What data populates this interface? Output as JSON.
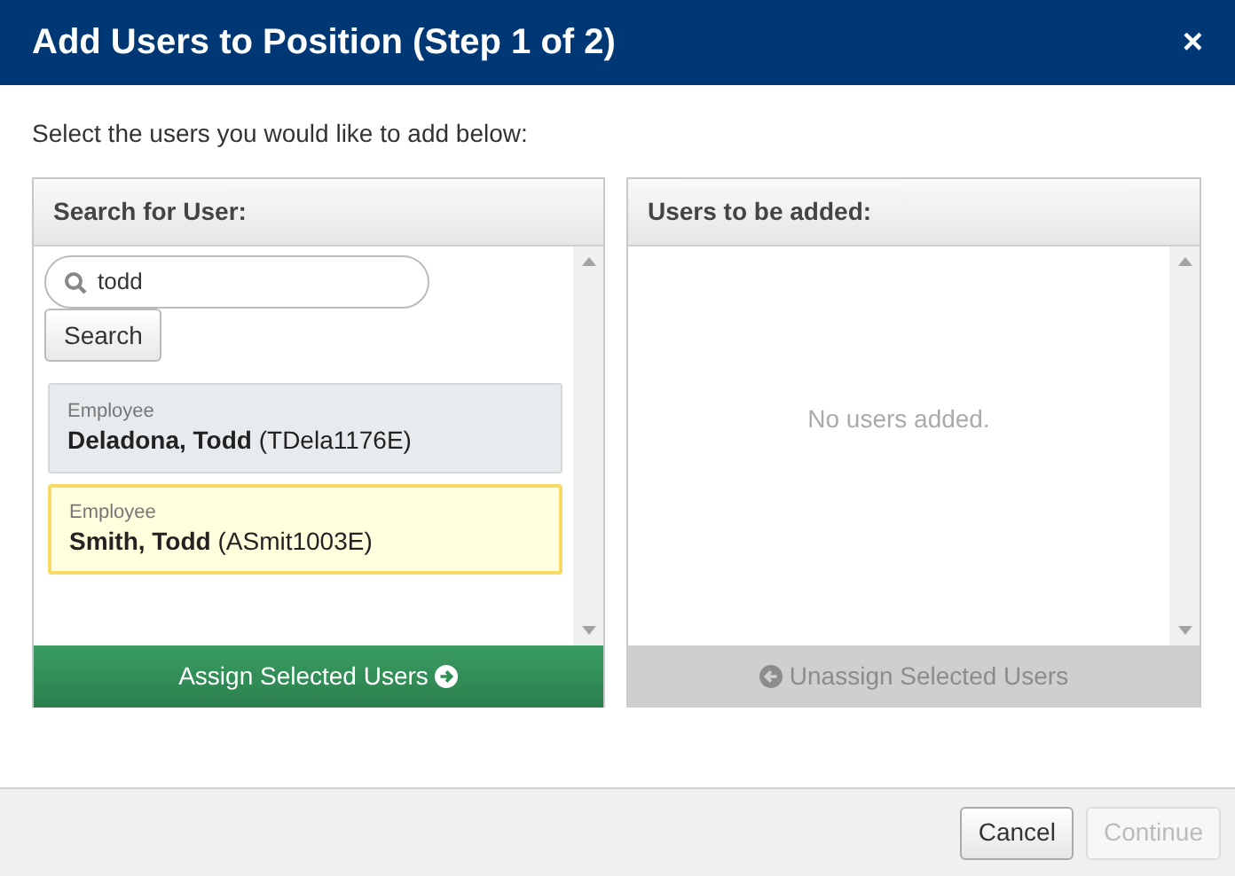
{
  "dialog": {
    "title": "Add Users to Position (Step 1 of 2)",
    "close": "×"
  },
  "instructions": "Select the users you would like to add below:",
  "search_panel": {
    "heading": "Search for User:",
    "search_value": "todd",
    "search_button": "Search",
    "results": [
      {
        "type": "Employee",
        "name": "Deladona, Todd",
        "code": "(TDela1176E)",
        "selected": false
      },
      {
        "type": "Employee",
        "name": "Smith, Todd",
        "code": "(ASmit1003E)",
        "selected": true
      }
    ],
    "action": {
      "label": "Assign Selected Users",
      "disabled": false
    }
  },
  "added_panel": {
    "heading": "Users to be added:",
    "empty_message": "No users added.",
    "action": {
      "label": "Unassign Selected Users",
      "disabled": true
    }
  },
  "footer": {
    "buttons": [
      {
        "label": "Cancel",
        "disabled": false
      },
      {
        "label": "Continue",
        "disabled": true
      }
    ]
  }
}
